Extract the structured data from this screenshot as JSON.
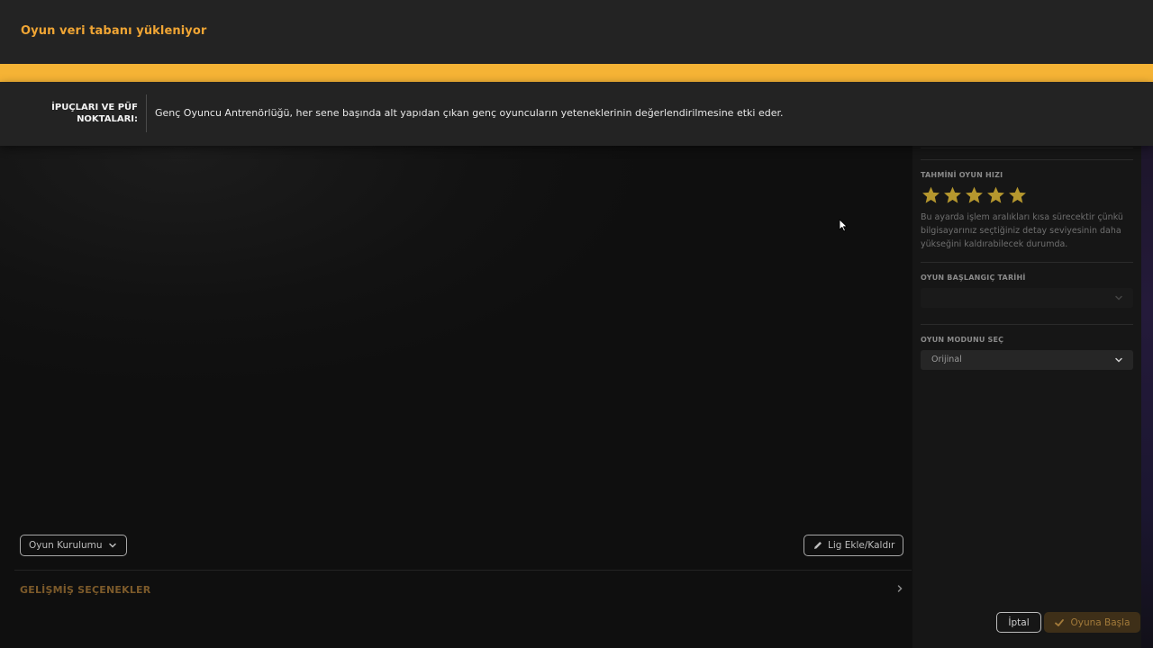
{
  "loading": {
    "title": "Oyun veri tabanı yükleniyor",
    "progress": 1.0,
    "accent_color": "#f5b335"
  },
  "tips": {
    "label": "İPUÇLARI VE PÜF NOKTALARI:",
    "text": "Genç Oyuncu Antrenörlüğü, her sene başında alt yapıdan çıkan genç oyuncuların yeteneklerinin değerlendirilmesine etki eder."
  },
  "sidebar": {
    "speed_label": "TAHMİNİ OYUN HIZI",
    "speed_rating": 5,
    "speed_max": 5,
    "star_color": "#b5972e",
    "speed_description": "Bu ayarda işlem aralıkları kısa sürecektir çünkü bilgisayarınız seçtiğiniz detay seviyesinin daha yükseğini kaldırabilecek durumda.",
    "start_date_label": "OYUN BAŞLANGIÇ TARİHİ",
    "start_date_value": "",
    "mode_label": "OYUN MODUNU SEÇ",
    "mode_value": "Orijinal"
  },
  "main": {
    "setup_button": "Oyun Kurulumu",
    "league_button": "Lig Ekle/Kaldır",
    "advanced_label": "GELİŞMİŞ SEÇENEKLER"
  },
  "footer": {
    "cancel_label": "İptal",
    "start_label": "Oyuna Başla"
  },
  "icons": {
    "pencil": "pencil-icon",
    "chevron_down": "chevron-down-icon",
    "chevron_right": "chevron-right-icon",
    "check": "check-icon",
    "star": "star-icon",
    "cursor": "cursor-icon"
  }
}
